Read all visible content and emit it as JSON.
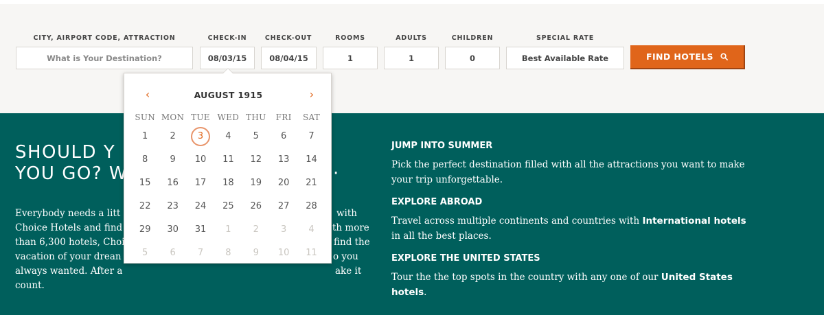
{
  "search": {
    "destination": {
      "label": "CITY, AIRPORT CODE, ATTRACTION",
      "placeholder": "What is Your Destination?"
    },
    "checkin": {
      "label": "CHECK-IN",
      "value": "08/03/15"
    },
    "checkout": {
      "label": "CHECK-OUT",
      "value": "08/04/15"
    },
    "rooms": {
      "label": "ROOMS",
      "value": "1"
    },
    "adults": {
      "label": "ADULTS",
      "value": "1"
    },
    "children": {
      "label": "CHILDREN",
      "value": "0"
    },
    "rate": {
      "label": "SPECIAL RATE",
      "value": "Best Available Rate"
    },
    "find_label": "FIND HOTELS"
  },
  "calendar": {
    "prev": "‹",
    "next": "›",
    "title": "AUGUST 1915",
    "weekdays": [
      "SUN",
      "MON",
      "TUE",
      "WED",
      "THU",
      "FRI",
      "SAT"
    ],
    "weeks": [
      [
        "1",
        "2",
        "3",
        "4",
        "5",
        "6",
        "7"
      ],
      [
        "8",
        "9",
        "10",
        "11",
        "12",
        "13",
        "14"
      ],
      [
        "15",
        "16",
        "17",
        "18",
        "19",
        "20",
        "21"
      ],
      [
        "22",
        "23",
        "24",
        "25",
        "26",
        "27",
        "28"
      ],
      [
        "29",
        "30",
        "31",
        "1",
        "2",
        "3",
        "4"
      ],
      [
        "5",
        "6",
        "7",
        "8",
        "9",
        "10",
        "11"
      ]
    ],
    "selected_day": "3"
  },
  "promo": {
    "headline_line1": "SHOULD Y",
    "headline_line2": "YOU GO? W",
    "headline_tail1": "",
    "headline_tail2": "·",
    "body_lines": [
      "Everybody needs a litt",
      "Choice Hotels and find",
      "than 6,300 hotels, Choi",
      "vacation of your drean",
      "always wanted. After a",
      "count."
    ],
    "body_tails": [
      "with",
      "th more",
      "find the",
      "o you",
      "ake it",
      ""
    ],
    "sections": [
      {
        "title": "JUMP INTO SUMMER",
        "text": "Pick the perfect destination filled with all the attractions you want to make your trip unforgettable.",
        "bold": ""
      },
      {
        "title": "EXPLORE ABROAD",
        "text": "Travel across multiple continents and countries with ",
        "bold": "International hotels",
        "tail": " in all the best places."
      },
      {
        "title": "EXPLORE THE UNITED STATES",
        "text": "Tour the the top spots in the country with any one of our ",
        "bold": "United States hotels",
        "tail": "."
      }
    ]
  },
  "colors": {
    "accent": "#e0651a",
    "promo_bg": "#005f5c",
    "search_bg": "#f7f6f4"
  }
}
